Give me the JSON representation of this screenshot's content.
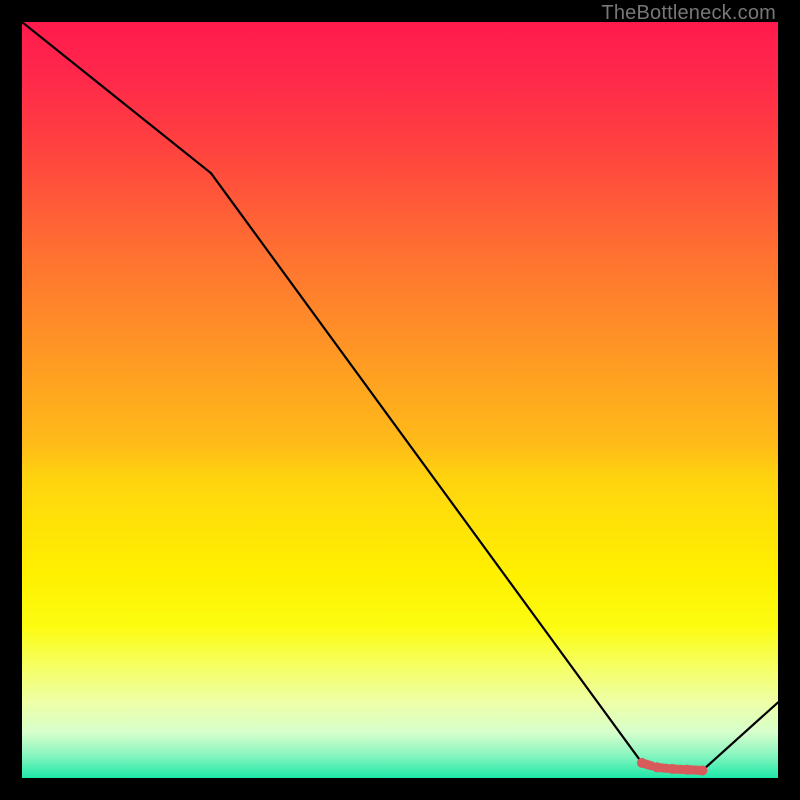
{
  "watermark": "TheBottleneck.com",
  "chart_data": {
    "type": "line",
    "title": "",
    "xlabel": "",
    "ylabel": "",
    "xlim": [
      0,
      100
    ],
    "ylim": [
      0,
      100
    ],
    "x": [
      0,
      25,
      82,
      90,
      100
    ],
    "values": [
      100,
      80,
      2,
      1,
      10
    ],
    "markers": {
      "x": [
        82,
        84,
        86,
        88,
        90
      ],
      "values": [
        2.0,
        1.4,
        1.2,
        1.1,
        1.0
      ],
      "color": "#d85a5a"
    },
    "line_color": "#000000",
    "background": "red-yellow-green vertical gradient"
  }
}
